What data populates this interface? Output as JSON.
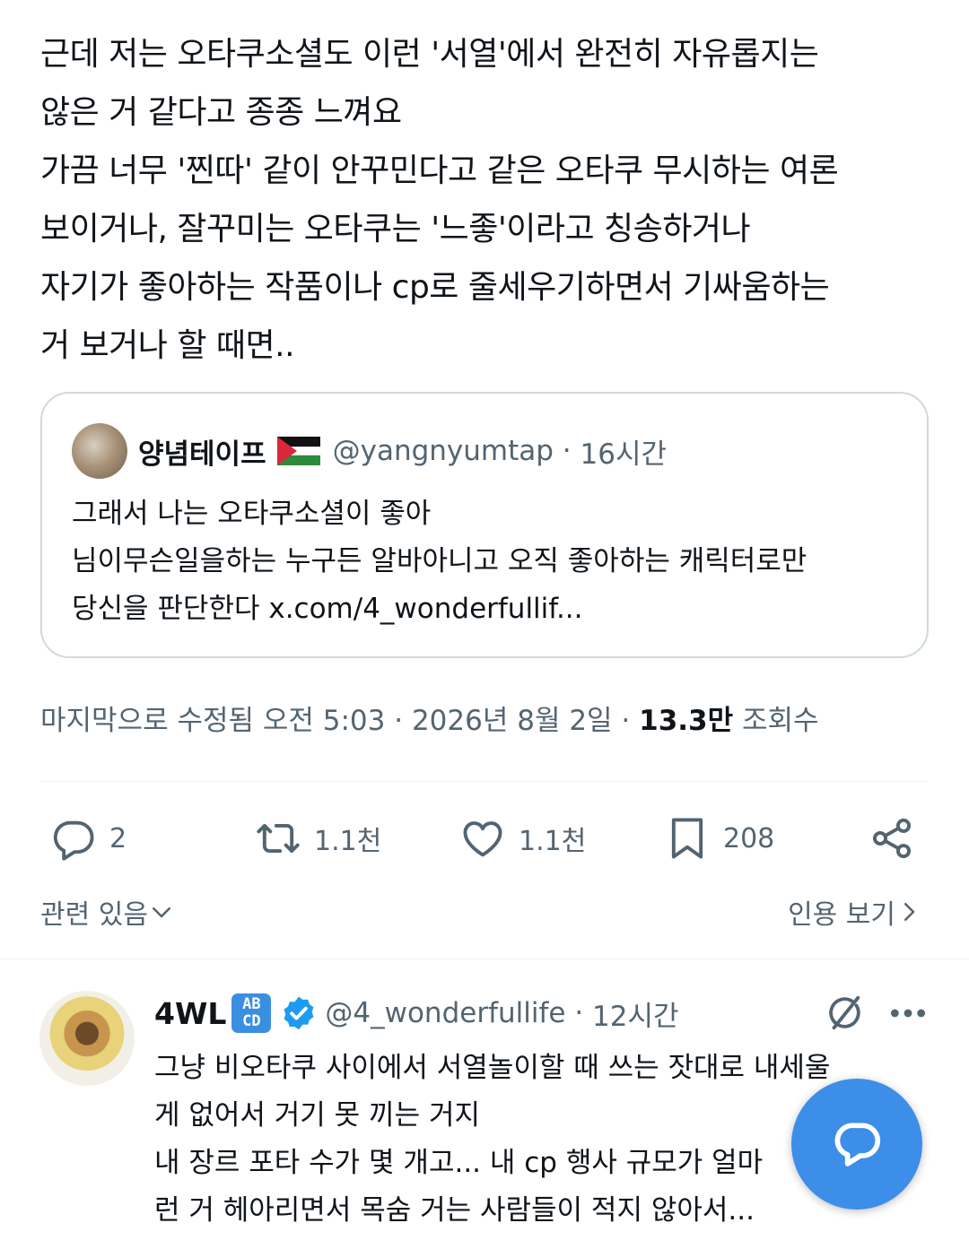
{
  "main_tweet": {
    "lines": [
      "근데 저는 오타쿠소셜도 이런 '서열'에서 완전히 자유롭지는",
      "않은 거 같다고 종종 느껴요",
      "가끔 너무 '찐따' 같이 안꾸민다고 같은 오타쿠 무시하는 여론",
      "보이거나, 잘꾸미는 오타쿠는 '느좋'이라고 칭송하거나",
      "자기가 좋아하는 작품이나 cp로 줄세우기하면서 기싸움하는",
      "거 보거나 할 때면.."
    ]
  },
  "quoted_tweet": {
    "name": "양념테이프",
    "handle": "@yangnyumtap",
    "time": "16시간",
    "lines": [
      "그래서 나는 오타쿠소셜이 좋아",
      "님이무슨일을하는 누구든 알바아니고 오직 좋아하는 캐릭터로만",
      "당신을 판단한다 x.com/4_wonderfullif..."
    ]
  },
  "meta": {
    "edited": "마지막으로 수정됨 오전 5:03",
    "date": "2026년 8월 2일",
    "views_count": "13.3만",
    "views_label": "조회수"
  },
  "actions": {
    "replies": "2",
    "reposts": "1.1천",
    "likes": "1.1천",
    "bookmarks": "208"
  },
  "links": {
    "related": "관련 있음",
    "quotes": "인용 보기"
  },
  "reply": {
    "name": "4WL",
    "badge": "AB CD",
    "handle": "@4_wonderfullife",
    "time": "12시간",
    "lines": [
      "그냥 비오타쿠 사이에서 서열놀이할 때 쓰는 잣대로 내세울",
      "게 없어서 거기 못 끼는 거지",
      "내 장르 포타 수가 몇 개고... 내 cp 행사 규모가 얼마",
      "런 거 헤아리면서 목숨 거는 사람들이 적지 않아서..."
    ]
  },
  "colors": {
    "accent": "#1d9bf0",
    "fab": "#3d8ee8",
    "secondary_text": "#536471",
    "border": "#cfd9de"
  },
  "icons": [
    "reply-icon",
    "repost-icon",
    "like-icon",
    "bookmark-icon",
    "share-icon",
    "verified-icon",
    "grok-icon",
    "more-icon",
    "compose-icon",
    "chevron-down-icon",
    "chevron-right-icon"
  ]
}
